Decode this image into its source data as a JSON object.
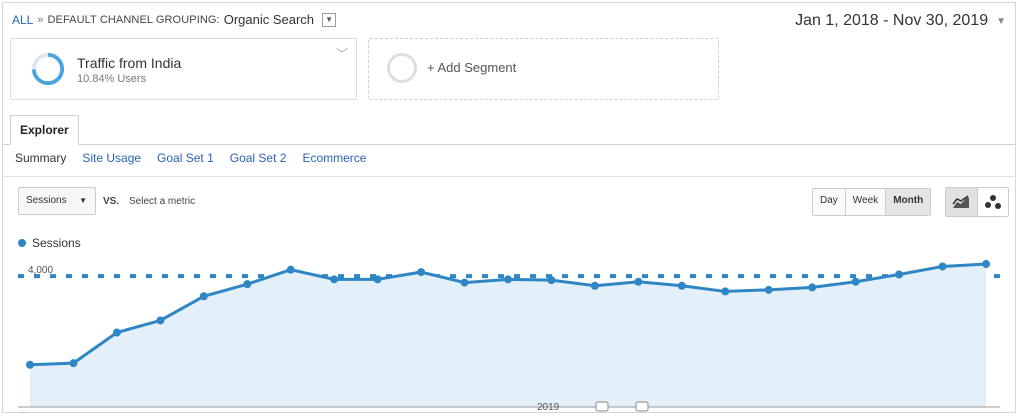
{
  "breadcrumb": {
    "all": "ALL",
    "separator": "»",
    "dimension": "DEFAULT CHANNEL GROUPING:",
    "value": "Organic Search"
  },
  "date_range": "Jan 1, 2018 - Nov 30, 2019",
  "segments": {
    "active": {
      "title": "Traffic from India",
      "subtitle": "10.84% Users"
    },
    "add_label": "+ Add Segment"
  },
  "tabs": {
    "explorer": "Explorer"
  },
  "subtabs": [
    "Summary",
    "Site Usage",
    "Goal Set 1",
    "Goal Set 2",
    "Ecommerce"
  ],
  "controls": {
    "metric": "Sessions",
    "vs": "VS.",
    "select_metric": "Select a metric",
    "granularity": [
      "Day",
      "Week",
      "Month"
    ],
    "selected_granularity": "Month"
  },
  "chart_data": {
    "type": "area",
    "series": [
      {
        "name": "Sessions",
        "color": "#2f86c4",
        "values": [
          2900,
          2920,
          3300,
          3450,
          3750,
          3900,
          4080,
          3960,
          3960,
          4050,
          3920,
          3960,
          3950,
          3880,
          3930,
          3880,
          3810,
          3830,
          3860,
          3930,
          4020,
          4120,
          4150
        ]
      }
    ],
    "y_ticks": [
      "4,000"
    ],
    "x_label": "2019",
    "ylim": [
      2500,
      4200
    ],
    "grid": false
  },
  "footer_dots": "..."
}
